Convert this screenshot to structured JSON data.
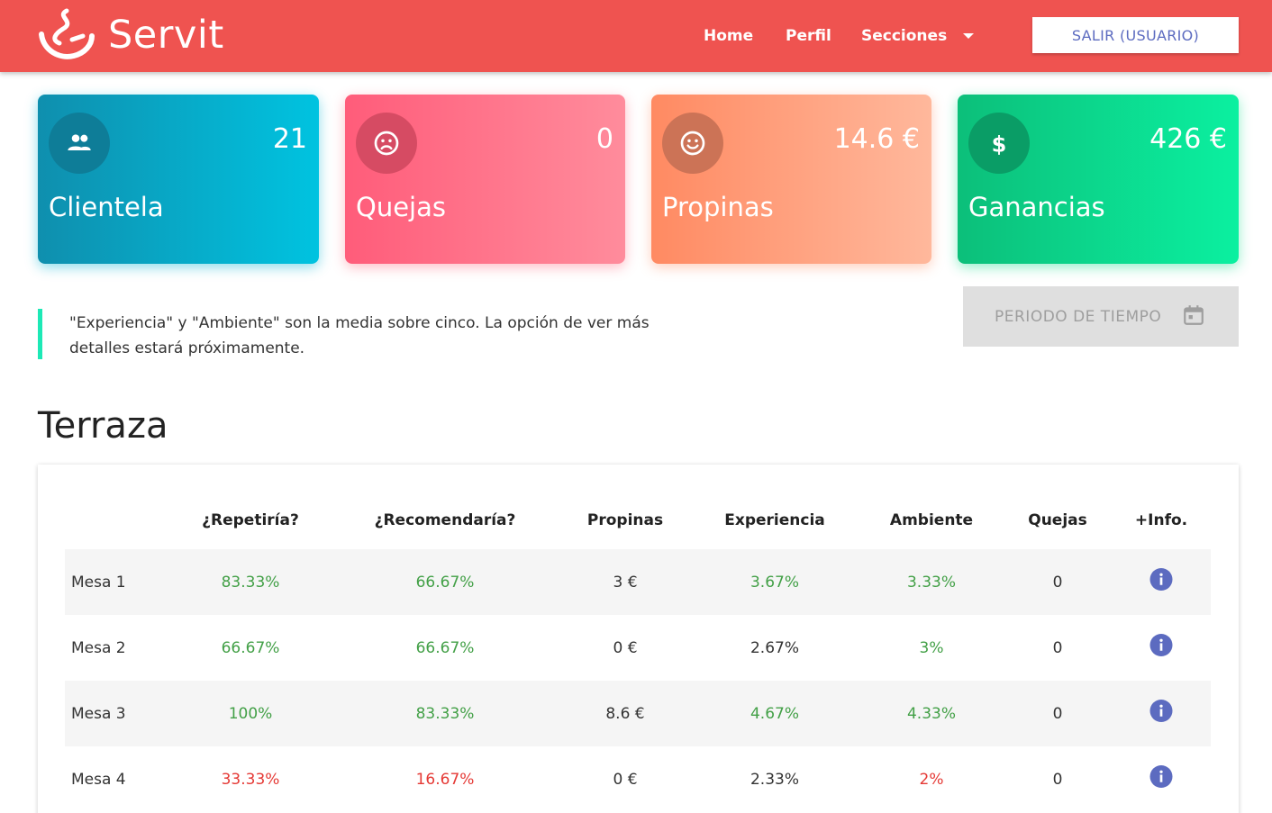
{
  "header": {
    "brand": "Servit",
    "nav": [
      "Home",
      "Perfil",
      "Secciones"
    ],
    "logout_label": "SALIR (USUARIO)"
  },
  "cards": [
    {
      "label": "Clientela",
      "value": "21",
      "icon": "people-icon"
    },
    {
      "label": "Quejas",
      "value": "0",
      "icon": "sad-face-icon"
    },
    {
      "label": "Propinas",
      "value": "14.6 €",
      "icon": "smile-face-icon"
    },
    {
      "label": "Ganancias",
      "value": "426 €",
      "icon": "dollar-icon"
    }
  ],
  "note": "\"Experiencia\" y \"Ambiente\" son la media sobre cinco. La opción de ver más detalles estará próximamente.",
  "period_button": "PERIODO DE TIEMPO",
  "section_title": "Terraza",
  "table": {
    "headers": [
      "",
      "¿Repetiría?",
      "¿Recomendaría?",
      "Propinas",
      "Experiencia",
      "Ambiente",
      "Quejas",
      "+Info."
    ],
    "rows": [
      {
        "name": "Mesa 1",
        "repetiria": "83.33%",
        "recomendaria": "66.67%",
        "propinas": "3 €",
        "experiencia": "3.67%",
        "ambiente": "3.33%",
        "quejas": "0"
      },
      {
        "name": "Mesa 2",
        "repetiria": "66.67%",
        "recomendaria": "66.67%",
        "propinas": "0 €",
        "experiencia": "2.67%",
        "ambiente": "3%",
        "quejas": "0"
      },
      {
        "name": "Mesa 3",
        "repetiria": "100%",
        "recomendaria": "83.33%",
        "propinas": "8.6 €",
        "experiencia": "4.67%",
        "ambiente": "4.33%",
        "quejas": "0"
      },
      {
        "name": "Mesa 4",
        "repetiria": "33.33%",
        "recomendaria": "16.67%",
        "propinas": "0 €",
        "experiencia": "2.33%",
        "ambiente": "2%",
        "quejas": "0"
      }
    ]
  },
  "colors": {
    "header": "#ef5350",
    "positive": "#43a047",
    "negative": "#e53935",
    "accent": "#5c6bc0"
  }
}
